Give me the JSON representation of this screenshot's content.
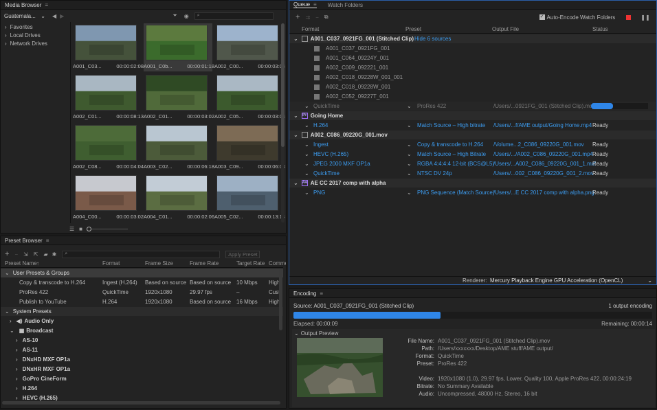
{
  "media_browser": {
    "title": "Media Browser",
    "location": "Guatemala...",
    "tree": [
      "Favorites",
      "Local Drives",
      "Network Drives"
    ],
    "clips": [
      {
        "name": "A001_C03...",
        "dur": "00:00:02:08",
        "sky": "#7f97b0",
        "ground": "#45523b",
        "sel": false
      },
      {
        "name": "A001_C0b...",
        "dur": "00:00:01:18",
        "sky": "#5c7a3e",
        "ground": "#3b6b2c",
        "sel": true
      },
      {
        "name": "A002_C00...",
        "dur": "00:00:03:04",
        "sky": "#9db3cc",
        "ground": "#50574b",
        "sel": false
      },
      {
        "name": "A002_C01...",
        "dur": "00:00:08:13",
        "sky": "#a9b7c2",
        "ground": "#3f5a2f",
        "sel": false
      },
      {
        "name": "A002_C01...",
        "dur": "00:00:03:02",
        "sky": "#2f4a24",
        "ground": "#506a3a",
        "sel": false
      },
      {
        "name": "A002_C05...",
        "dur": "00:00:03:04",
        "sky": "#aab8c4",
        "ground": "#3c5a2d",
        "sel": false
      },
      {
        "name": "A002_C08...",
        "dur": "00:00:04:04",
        "sky": "#4d6b39",
        "ground": "#3f5e30",
        "sel": false
      },
      {
        "name": "A003_C02...",
        "dur": "00:00:06:18",
        "sky": "#b9c6d1",
        "ground": "#4c5b3a",
        "sel": false
      },
      {
        "name": "A003_C09...",
        "dur": "00:00:06:08",
        "sky": "#7d6b55",
        "ground": "#3e3a2d",
        "sel": false
      },
      {
        "name": "A004_C00...",
        "dur": "00:00:03:02",
        "sky": "#c7c9cf",
        "ground": "#7a5a49",
        "sel": false
      },
      {
        "name": "A004_C01...",
        "dur": "00:00:02:06",
        "sky": "#c2ccd6",
        "ground": "#5b6d42",
        "sel": false
      },
      {
        "name": "A005_C02...",
        "dur": "00:00:13:14",
        "sky": "#9db0c4",
        "ground": "#4e5f6e",
        "sel": false
      }
    ]
  },
  "preset_browser": {
    "title": "Preset Browser",
    "apply": "Apply Preset",
    "cols": [
      "Preset Name",
      "Format",
      "Frame Size",
      "Frame Rate",
      "Target Rate",
      "Comme"
    ],
    "user_group": "User Presets & Groups",
    "user_presets": [
      {
        "name": "Copy & transcode to H.264",
        "format": "Ingest (H.264)",
        "size": "Based on source",
        "rate": "Based on source",
        "target": "10 Mbps",
        "comment": "High"
      },
      {
        "name": "ProRes 422",
        "format": "QuickTime",
        "size": "1920x1080",
        "rate": "29.97 fps",
        "target": "–",
        "comment": "Cust"
      },
      {
        "name": "Publish to YouTube",
        "format": "H.264",
        "size": "1920x1080",
        "rate": "Based on source",
        "target": "16 Mbps",
        "comment": "High"
      }
    ],
    "system_group": "System Presets",
    "system_items": [
      {
        "label": "Audio Only",
        "level": 1,
        "open": false
      },
      {
        "label": "Broadcast",
        "level": 1,
        "open": true
      },
      {
        "label": "AS-10",
        "level": 2,
        "open": false
      },
      {
        "label": "AS-11",
        "level": 2,
        "open": false
      },
      {
        "label": "DNxHD MXF OP1a",
        "level": 2,
        "open": false
      },
      {
        "label": "DNxHR MXF OP1a",
        "level": 2,
        "open": false
      },
      {
        "label": "GoPro CineForm",
        "level": 2,
        "open": false
      },
      {
        "label": "H.264",
        "level": 2,
        "open": false
      },
      {
        "label": "HEVC (H.265)",
        "level": 2,
        "open": false
      }
    ]
  },
  "queue": {
    "tab_queue": "Queue",
    "tab_watch": "Watch Folders",
    "auto_encode": "Auto-Encode Watch Folders",
    "cols": [
      "Format",
      "Preset",
      "Output File",
      "Status"
    ],
    "stitched": {
      "name": "A001_C037_0921FG_001 (Stitched Clip)",
      "hide": "Hide 6 sources",
      "sources": [
        "A001_C037_0921FG_001",
        "A001_C064_09224Y_001",
        "A002_C009_092221_001",
        "A002_C018_09228W_001_001",
        "A002_C018_09228W_001",
        "A002_C052_09227T_001"
      ],
      "output": {
        "format": "QuickTime",
        "preset": "ProRes 422",
        "file": "/Users/...0921FG_001 (Stitched Clip).mov",
        "progress": 0.38
      }
    },
    "groups": [
      {
        "name": "Going Home",
        "outputs": [
          {
            "format": "H.264",
            "preset": "Match Source – High bitrate",
            "file": "/Users/...f/AME output/Going Home.mp4",
            "status": "Ready"
          }
        ]
      },
      {
        "name": "A002_C086_09220G_001.mov",
        "outputs": [
          {
            "format": "Ingest",
            "preset": "Copy & transcode to H.264",
            "file": "/Volume...2_C086_09220G_001.mov",
            "status": "Ready"
          },
          {
            "format": "HEVC (H.265)",
            "preset": "Match Source – High Bitrate",
            "file": "/Users/.../A002_C086_09220G_001.mp4",
            "status": "Ready"
          },
          {
            "format": "JPEG 2000 MXF OP1a",
            "preset": "RGBA 4:4:4:4 12-bit (BCS@L5)",
            "file": "/Users/...A002_C086_09220G_001_1.mxf",
            "status": "Ready"
          },
          {
            "format": "QuickTime",
            "preset": "NTSC DV 24p",
            "file": "/Users/...002_C086_09220G_001_2.mov",
            "status": "Ready"
          }
        ]
      },
      {
        "name": "AE CC 2017 comp with alpha",
        "outputs": [
          {
            "format": "PNG",
            "preset": "PNG Sequence (Match Source)",
            "file": "/Users/...E CC 2017 comp with alpha.png",
            "status": "Ready"
          }
        ]
      }
    ],
    "renderer_label": "Renderer:",
    "renderer": "Mercury Playback Engine GPU Acceleration (OpenCL)"
  },
  "encoding": {
    "title": "Encoding",
    "source": "Source: A001_C037_0921FG_001 (Stitched Clip)",
    "count": "1 output encoding",
    "progress": 0.41,
    "elapsed": "Elapsed: 00:00:09",
    "remaining": "Remaining: 00:00:14",
    "preview": "Output Preview",
    "info": [
      {
        "k": "File Name:",
        "v": "A001_C037_0921FG_001 (Stitched Clip).mov"
      },
      {
        "k": "Path:",
        "v": "/Users/xxxxxxx/Desktop/AME stuff/AME output/"
      },
      {
        "k": "Format:",
        "v": "QuickTime"
      },
      {
        "k": "Preset:",
        "v": "ProRes 422"
      },
      {
        "k": "",
        "v": ""
      },
      {
        "k": "Video:",
        "v": "1920x1080 (1.0), 29.97 fps, Lower, Quality 100, Apple ProRes 422, 00:00:24:19"
      },
      {
        "k": "Bitrate:",
        "v": "No Summary Available"
      },
      {
        "k": "Audio:",
        "v": "Uncompressed, 48000 Hz, Stereo, 16 bit"
      }
    ]
  }
}
